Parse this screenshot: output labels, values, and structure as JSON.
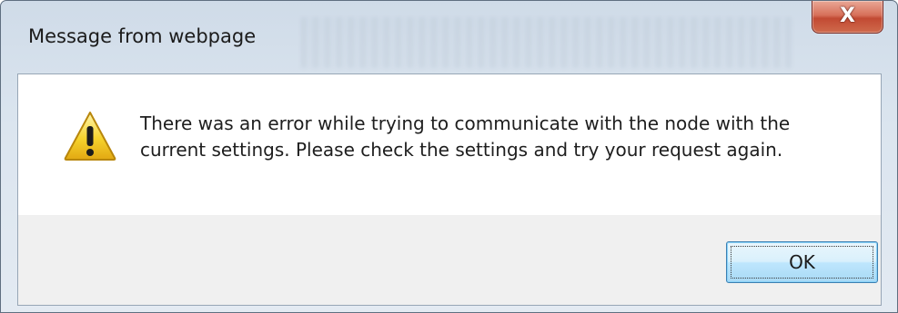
{
  "dialog": {
    "title": "Message from webpage",
    "close_icon": "close-icon",
    "close_glyph": "X",
    "icon": "warning-icon",
    "message": "There was an error while trying to communicate with the node with the current settings.  Please check the settings and try your request again.",
    "ok_label": "OK"
  },
  "colors": {
    "close_button": "#c24a33",
    "ok_button_border": "#3c7fb1",
    "footer_bg": "#f0f0f0",
    "warning_yellow": "#f6d32d"
  }
}
